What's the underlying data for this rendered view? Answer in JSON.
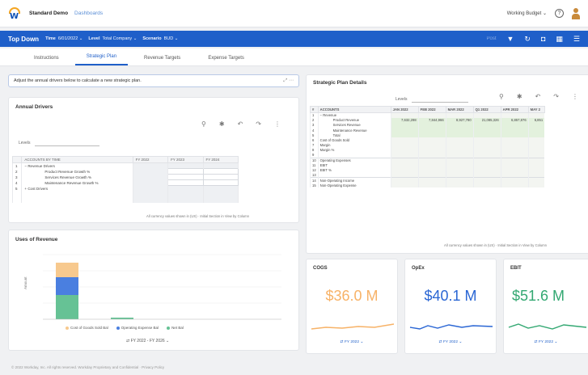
{
  "header": {
    "crumb_main": "Standard Demo",
    "crumb_sub": "Dashboards",
    "context": "Working Budget",
    "context_chevron": "⌄",
    "help": "?"
  },
  "toolbar": {
    "title": "Top Down",
    "filters": [
      {
        "label": "Time",
        "value": "6/01/2022"
      },
      {
        "label": "Level",
        "value": "Total Company"
      },
      {
        "label": "Scenario",
        "value": "BUD"
      }
    ],
    "post_label": "Post"
  },
  "tabs": [
    "Instructions",
    "Strategic Plan",
    "Revenue Targets",
    "Expense Targets"
  ],
  "instruction": {
    "text": "Adjust the annual drivers below to calculate a new strategic plan."
  },
  "annual_drivers": {
    "title": "Annual Drivers",
    "levels_label": "Levels",
    "levels_value": "",
    "columns": [
      "",
      "ACCOUNTS BY TIME",
      "FY 2022",
      "FY 2023",
      "FY 2024"
    ],
    "rows": [
      {
        "num": "1",
        "label": "Revenue Drivers",
        "indent": 1
      },
      {
        "num": "2",
        "label": "Product Revenue Growth %",
        "indent": 2
      },
      {
        "num": "3",
        "label": "Services Revenue Growth %",
        "indent": 2
      },
      {
        "num": "4",
        "label": "Maintenance Revenue Growth %",
        "indent": 2
      },
      {
        "num": "5",
        "label": "Cost Drivers",
        "indent": 1
      }
    ],
    "footnote": "All currency values shown in (US) · Initial Section in View by Column"
  },
  "uses_of_revenue": {
    "title": "Uses of Revenue",
    "ylabel": "Amount",
    "legend": [
      {
        "label": "Cost of Goods Sold Bal",
        "color": "#f7c98e"
      },
      {
        "label": "Operating Expense Bal",
        "color": "#4a7fe0"
      },
      {
        "label": "Net Bal",
        "color": "#66c295"
      }
    ],
    "period_label": "FY 2022 - FY 2026"
  },
  "strategic_plan": {
    "title": "Strategic Plan Details",
    "levels_label": "Levels",
    "columns": [
      "#",
      "ACCOUNTS",
      "JAN 2022",
      "FEB 2022",
      "MAR 2022",
      "Q1 2022",
      "APR 2022",
      "MAY 2"
    ],
    "rows": [
      {
        "num": "1",
        "label": "Revenue",
        "indent": 0,
        "vals": [
          "",
          "",
          "",
          "",
          "",
          ""
        ]
      },
      {
        "num": "2",
        "label": "Product Revenue",
        "indent": 2,
        "vals": [
          "7,632,298",
          "7,844,966",
          "8,927,780",
          "21,085,326",
          "6,857,876",
          "6,851"
        ],
        "green": true
      },
      {
        "num": "3",
        "label": "Services Revenue",
        "indent": 2,
        "vals": "",
        "green": true
      },
      {
        "num": "4",
        "label": "Maintenance Revenue",
        "indent": 2,
        "vals": "",
        "green": true
      },
      {
        "num": "5",
        "label": "Total",
        "indent": 2,
        "vals": "",
        "green": true
      },
      {
        "num": "6",
        "label": "Cost of Goods Sold",
        "indent": 0,
        "vals": ""
      },
      {
        "num": "7",
        "label": "Margin",
        "indent": 0,
        "vals": ""
      },
      {
        "num": "8",
        "label": "Margin %",
        "indent": 0,
        "vals": ""
      },
      {
        "num": "9",
        "label": "",
        "indent": 0,
        "vals": ""
      },
      {
        "num": "10",
        "label": "Operating Expenses",
        "indent": 0,
        "vals": "",
        "sep": true
      },
      {
        "num": "11",
        "label": "EBIT",
        "indent": 0,
        "vals": ""
      },
      {
        "num": "12",
        "label": "EBIT %",
        "indent": 0,
        "vals": ""
      },
      {
        "num": "13",
        "label": "",
        "indent": 0,
        "vals": ""
      },
      {
        "num": "14",
        "label": "Non-Operating Income",
        "indent": 0,
        "vals": "",
        "sep": true
      },
      {
        "num": "15",
        "label": "Non-Operating Expense",
        "indent": 0,
        "vals": ""
      }
    ],
    "footnote": "All currency values shown in (US) · Initial Section in View by Column"
  },
  "kpis": [
    {
      "label": "COGS",
      "value": "$36.0 M",
      "color": "#f7b267",
      "line": "#f7b267",
      "period": "FY 2022"
    },
    {
      "label": "OpEx",
      "value": "$40.1 M",
      "color": "#2a66d4",
      "line": "#2a66d4",
      "period": "FY 2022"
    },
    {
      "label": "EBIT",
      "value": "$51.6 M",
      "color": "#33a872",
      "line": "#33a872",
      "period": "FY 2022"
    }
  ],
  "footer": {
    "text": "© 2022 Workday, Inc. All rights reserved. Workday Proprietary and Confidential · Privacy Policy"
  }
}
